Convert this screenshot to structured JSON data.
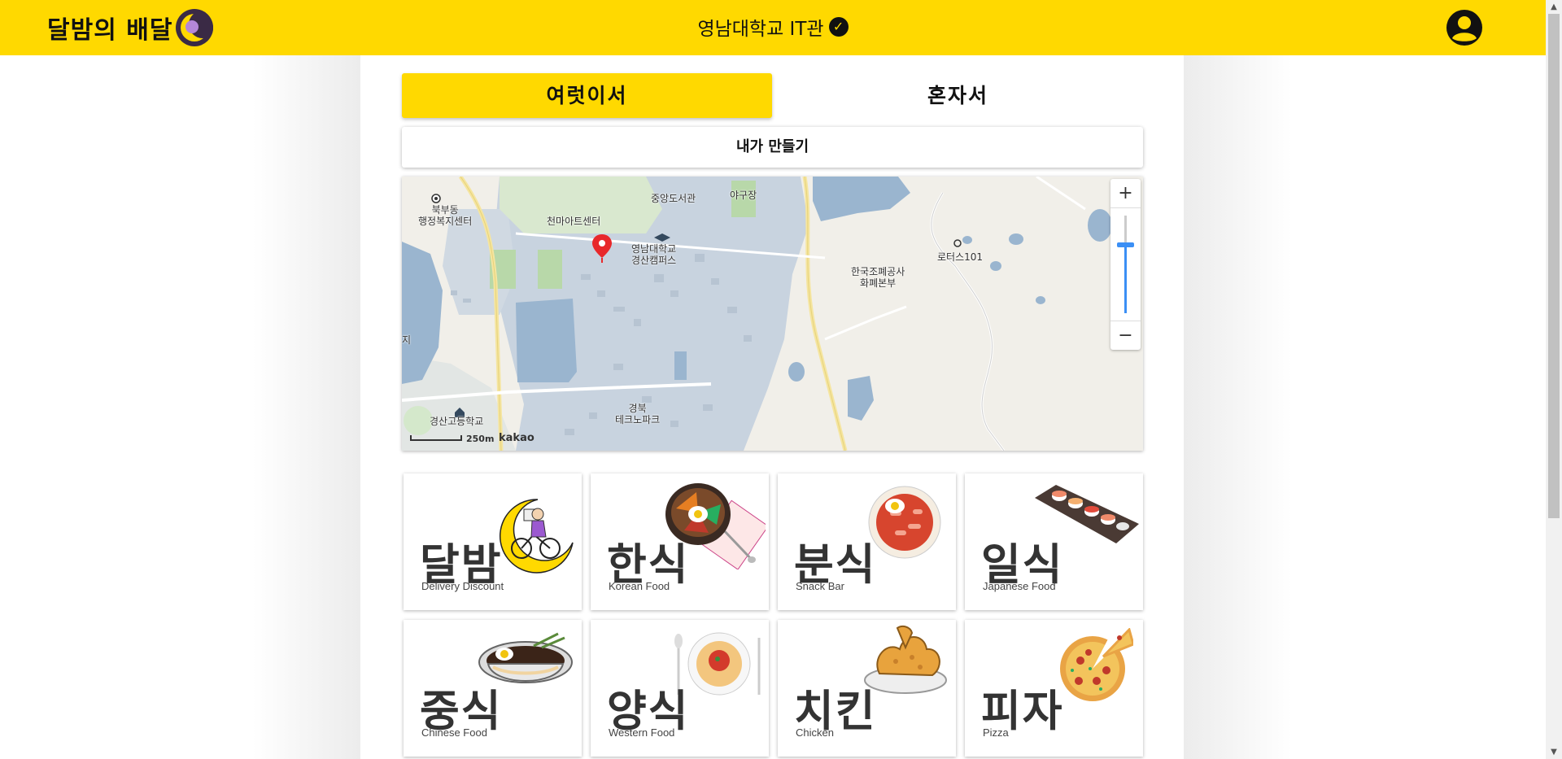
{
  "header": {
    "brand_text": "달밤의 배달",
    "location": "영남대학교 IT관",
    "brand_color": "#ffd900"
  },
  "mode_tabs": [
    {
      "label": "여럿이서",
      "active": true
    },
    {
      "label": "혼자서",
      "active": false
    }
  ],
  "make_button": "내가 만들기",
  "map": {
    "labels": {
      "bukbu": "북부동",
      "bukbu2": "행정복지센터",
      "cheonma": "천마아트센터",
      "library": "중앙도서관",
      "baseball": "야구장",
      "yu1": "영남대학교",
      "yu2": "경산캠퍼스",
      "komsco1": "한국조폐공사",
      "komsco2": "화폐본부",
      "lotus": "로터스101",
      "ji": "지",
      "gyeongbuk": "경북",
      "techno": "테크노파크",
      "highschool": "경산고등학교"
    },
    "zoom_in": "+",
    "zoom_out": "−",
    "zoom_level": 0.3,
    "scale": "250m",
    "attribution": "kakao"
  },
  "categories": [
    {
      "title": "달밤",
      "subtitle": "Delivery Discount",
      "art": "moon-rider"
    },
    {
      "title": "한식",
      "subtitle": "Korean Food",
      "art": "bibimbap"
    },
    {
      "title": "분식",
      "subtitle": "Snack Bar",
      "art": "tteokbokki"
    },
    {
      "title": "일식",
      "subtitle": "Japanese Food",
      "art": "sushi"
    },
    {
      "title": "중식",
      "subtitle": "Chinese Food",
      "art": "jajangmyeon"
    },
    {
      "title": "양식",
      "subtitle": "Western Food",
      "art": "pasta"
    },
    {
      "title": "치킨",
      "subtitle": "Chicken",
      "art": "fried-chicken"
    },
    {
      "title": "피자",
      "subtitle": "Pizza",
      "art": "pizza"
    }
  ]
}
